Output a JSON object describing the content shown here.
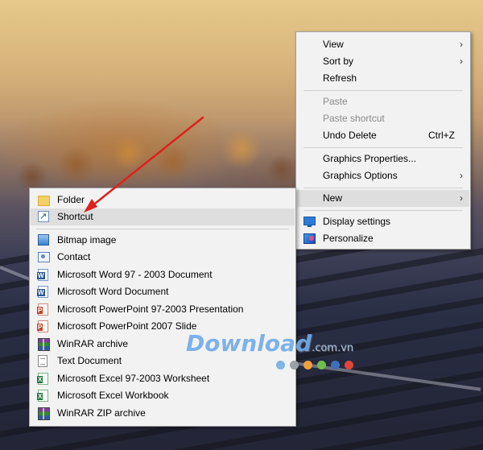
{
  "context_menu": {
    "items": [
      {
        "label": "View",
        "has_submenu": true
      },
      {
        "label": "Sort by",
        "has_submenu": true
      },
      {
        "label": "Refresh"
      },
      {
        "label": "Paste",
        "disabled": true
      },
      {
        "label": "Paste shortcut",
        "disabled": true
      },
      {
        "label": "Undo Delete",
        "shortcut": "Ctrl+Z"
      },
      {
        "label": "Graphics Properties..."
      },
      {
        "label": "Graphics Options",
        "has_submenu": true
      },
      {
        "label": "New",
        "has_submenu": true,
        "highlighted": true
      },
      {
        "label": "Display settings",
        "icon": "display-settings-icon"
      },
      {
        "label": "Personalize",
        "icon": "personalize-icon"
      }
    ]
  },
  "new_submenu": {
    "items": [
      {
        "label": "Folder",
        "icon": "folder-icon"
      },
      {
        "label": "Shortcut",
        "icon": "shortcut-icon",
        "highlighted": true
      },
      {
        "label": "Bitmap image",
        "icon": "bitmap-image-icon"
      },
      {
        "label": "Contact",
        "icon": "contact-icon"
      },
      {
        "label": "Microsoft Word 97 - 2003 Document",
        "icon": "word-document-icon"
      },
      {
        "label": "Microsoft Word Document",
        "icon": "word-document-icon"
      },
      {
        "label": "Microsoft PowerPoint 97-2003 Presentation",
        "icon": "powerpoint-icon"
      },
      {
        "label": "Microsoft PowerPoint 2007 Slide",
        "icon": "powerpoint-icon"
      },
      {
        "label": "WinRAR archive",
        "icon": "winrar-icon"
      },
      {
        "label": "Text Document",
        "icon": "text-document-icon"
      },
      {
        "label": "Microsoft Excel 97-2003 Worksheet",
        "icon": "excel-icon"
      },
      {
        "label": "Microsoft Excel Workbook",
        "icon": "excel-icon"
      },
      {
        "label": "WinRAR ZIP archive",
        "icon": "winrar-zip-icon"
      }
    ]
  },
  "watermark": {
    "text": "Download",
    "suffix": ".com.vn",
    "dot_colors": [
      "#7fb6e6",
      "#9aa1a8",
      "#f0a23a",
      "#6fbf4a",
      "#3f6fb8",
      "#e0453c"
    ]
  },
  "colors": {
    "menu_background": "#f2f2f2",
    "highlight": "#dedede",
    "disabled_text": "#8a8a8a",
    "arrow_annotation": "#e0201e"
  }
}
